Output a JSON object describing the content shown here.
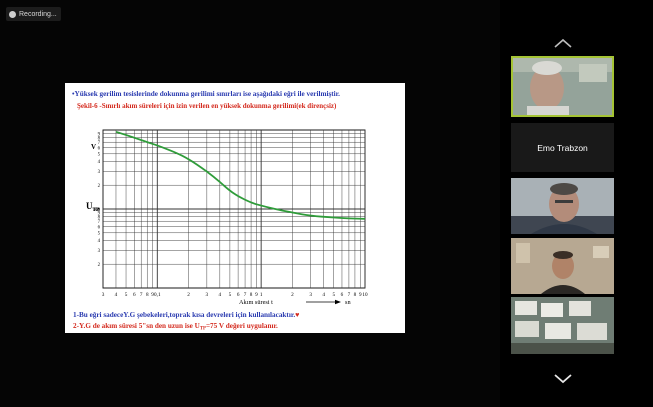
{
  "recording": {
    "label": "Recording..."
  },
  "slide": {
    "bullet_line": "•Yüksek gerilim tesislerinde dokunma gerilimi sınırları ise aşağıdaki eğri ile verilmiştir.",
    "figure_caption": "Şekil-6 -Sınırlı akım süreleri için izin verilen en yüksek dokunma gerilimi(ek dirençsiz)",
    "note_1": "1-Bu eğri sadeceY.G şebekeleri,toprak kısa devreleri için kullanılacaktır.",
    "note_1_marker": "♥",
    "note_2_prefix": "2-Y.G de  akım süresi 5\"sn den uzun ise U",
    "note_2_sub": "TP",
    "note_2_suffix": "=75 V değeri uygulanır.",
    "colors": {
      "blue": "#2a3bb0",
      "red": "#d42a1e",
      "curve": "#2f9c3a"
    }
  },
  "chart_data": {
    "type": "line",
    "title": "",
    "ylabel_main": "U",
    "ylabel_sub": "TP",
    "ylabel_unit": "V",
    "xlabel": "Akım süresi  t",
    "xlabel_unit": "sn",
    "x_scale": "log",
    "y_scale": "log",
    "xlim": [
      0.03,
      10
    ],
    "ylim": [
      10,
      1000
    ],
    "x_tick_labels": [
      "3",
      "4",
      "5",
      "6",
      "7",
      "8",
      "9",
      "0,1",
      "2",
      "3",
      "4",
      "5",
      "6",
      "7",
      "8",
      "9",
      "1",
      "2",
      "3",
      "4",
      "5",
      "6",
      "7",
      "8",
      "9",
      "10"
    ],
    "x_tick_values": [
      0.03,
      0.04,
      0.05,
      0.06,
      0.07,
      0.08,
      0.09,
      0.1,
      0.2,
      0.3,
      0.4,
      0.5,
      0.6,
      0.7,
      0.8,
      0.9,
      1,
      2,
      3,
      4,
      5,
      6,
      7,
      8,
      9,
      10
    ],
    "y_tick_labels_upper": [
      "9",
      "8",
      "7",
      "6",
      "5",
      "4",
      "3",
      "2"
    ],
    "y_tick_values_upper": [
      900,
      800,
      700,
      600,
      500,
      400,
      300,
      200
    ],
    "y_tick_label_mid": "100",
    "y_tick_labels_lower": [
      "9",
      "8",
      "7",
      "6",
      "5",
      "4",
      "3",
      "2"
    ],
    "y_tick_values_lower": [
      90,
      80,
      70,
      60,
      50,
      40,
      30,
      20
    ],
    "grid": true,
    "series": [
      {
        "x": [
          0.04,
          0.06,
          0.08,
          0.1,
          0.15,
          0.2,
          0.3,
          0.4,
          0.5,
          0.6,
          0.8,
          1,
          1.5,
          2,
          3,
          5,
          7,
          10
        ],
        "y": [
          950,
          800,
          700,
          640,
          520,
          430,
          300,
          220,
          170,
          145,
          120,
          110,
          97,
          90,
          82,
          78,
          76,
          75
        ]
      }
    ]
  },
  "sidebar": {
    "participant_name": "Emo Trabzon"
  }
}
